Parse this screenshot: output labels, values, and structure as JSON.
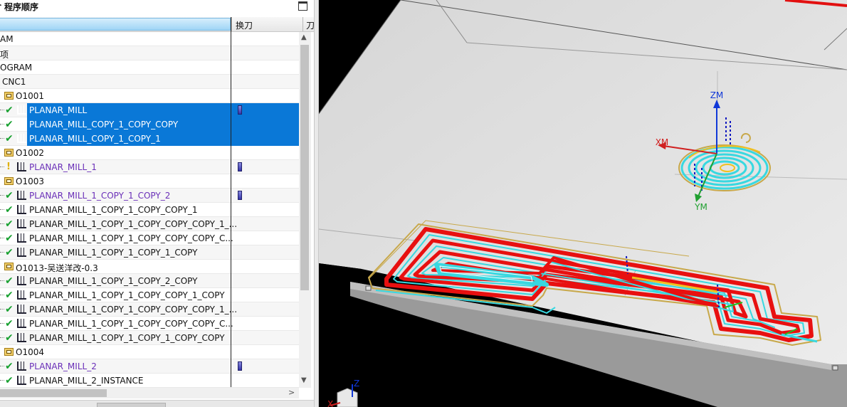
{
  "navigator": {
    "title": "程序顺序",
    "columns": [
      "",
      "换刀",
      "刀"
    ]
  },
  "rows": [
    {
      "indent": 0,
      "kind": "text",
      "label": "AM"
    },
    {
      "indent": 0,
      "kind": "text",
      "label": "项"
    },
    {
      "indent": 0,
      "kind": "text",
      "label": "OGRAM"
    },
    {
      "indent": 0,
      "kind": "text",
      "label": "CNC1"
    },
    {
      "kind": "group",
      "label": "O1001"
    },
    {
      "kind": "op",
      "status": "check",
      "label": "PLANAR_MILL",
      "selected": true,
      "tool": true
    },
    {
      "kind": "op",
      "status": "check",
      "label": "PLANAR_MILL_COPY_1_COPY_COPY",
      "selected": true
    },
    {
      "kind": "op",
      "status": "check",
      "label": "PLANAR_MILL_COPY_1_COPY_1",
      "selected": true
    },
    {
      "kind": "group",
      "label": "O1002"
    },
    {
      "kind": "op",
      "status": "bulb",
      "label": "PLANAR_MILL_1",
      "purple": true,
      "tool": true
    },
    {
      "kind": "group",
      "label": "O1003"
    },
    {
      "kind": "op",
      "status": "check",
      "label": "PLANAR_MILL_1_COPY_1_COPY_2",
      "purple": true,
      "tool": true
    },
    {
      "kind": "op",
      "status": "check",
      "label": "PLANAR_MILL_1_COPY_1_COPY_COPY_1"
    },
    {
      "kind": "op",
      "status": "check",
      "label": "PLANAR_MILL_1_COPY_1_COPY_COPY_COPY_1_..."
    },
    {
      "kind": "op",
      "status": "check",
      "label": "PLANAR_MILL_1_COPY_1_COPY_COPY_COPY_C..."
    },
    {
      "kind": "op",
      "status": "check",
      "label": "PLANAR_MILL_1_COPY_1_COPY_1_COPY"
    },
    {
      "kind": "group",
      "label": "O1013-吴送洋改-0.3"
    },
    {
      "kind": "op",
      "status": "check",
      "label": "PLANAR_MILL_1_COPY_1_COPY_2_COPY"
    },
    {
      "kind": "op",
      "status": "check",
      "label": "PLANAR_MILL_1_COPY_1_COPY_COPY_1_COPY"
    },
    {
      "kind": "op",
      "status": "check",
      "label": "PLANAR_MILL_1_COPY_1_COPY_COPY_COPY_1_..."
    },
    {
      "kind": "op",
      "status": "check",
      "label": "PLANAR_MILL_1_COPY_1_COPY_COPY_COPY_C..."
    },
    {
      "kind": "op",
      "status": "check",
      "label": "PLANAR_MILL_1_COPY_1_COPY_1_COPY_COPY"
    },
    {
      "kind": "group",
      "label": "O1004"
    },
    {
      "kind": "op",
      "status": "check",
      "label": "PLANAR_MILL_2",
      "purple": true,
      "tool": true
    },
    {
      "kind": "op",
      "status": "check",
      "label": "PLANAR_MILL_2_INSTANCE"
    }
  ],
  "viewport": {
    "mcs_labels": {
      "z": "ZM",
      "x": "XM",
      "y": "YM"
    },
    "triad_labels": {
      "z": "Z",
      "x": "X"
    },
    "colors": {
      "background": "#000000",
      "part_top": "#e4e4e4",
      "part_side": "#8e8e8e",
      "toolpath_cut": "#e81010",
      "toolpath_cyan": "#38d8e0",
      "toolpath_transfer": "#c8a84a",
      "selection": "#0a78d7"
    }
  }
}
